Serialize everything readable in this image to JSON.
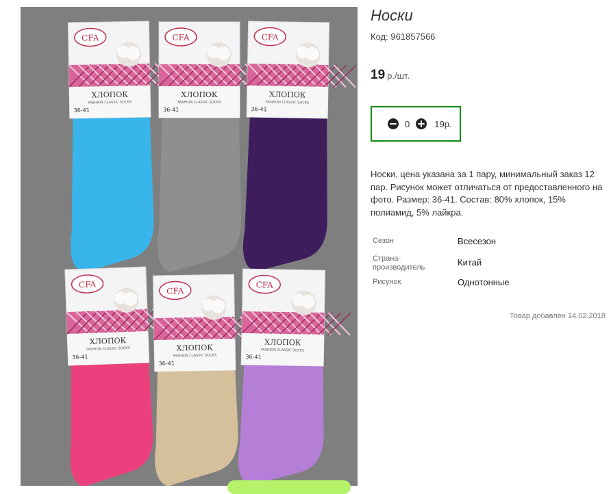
{
  "product": {
    "title": "Носки",
    "code_label": "Код:",
    "code_value": "961857566",
    "price_value": "19",
    "price_unit": "р./шт.",
    "quantity": "0",
    "total": "19р.",
    "description": "Носки, цена указана за 1 пару, минимальный заказ 12 пар. Рисунок может отличаться от предоставленного на фото. Размер: 36-41. Состав: 80% хлопок, 15% полиамид, 5% лайкра.",
    "added_text": "Товар добавлен 14.02.2018"
  },
  "properties": [
    {
      "label": "Сезон",
      "value": "Всесезон"
    },
    {
      "label": "Страна-производитель",
      "value": "Китай"
    },
    {
      "label": "Рисунок",
      "value": "Однотонные"
    }
  ],
  "photo": {
    "background": "#7f7f80",
    "pack_brand": "CFA",
    "pack_title": "ХЛОПОК",
    "pack_subtitle": "FASHION CLASSIC SOCKS",
    "pack_size": "36-41",
    "sock_colors": [
      "#38b6ec",
      "#8f8f91",
      "#3d1d5c",
      "#ec3f7d",
      "#d6c09c",
      "#b57fd8"
    ]
  },
  "colors": {
    "accent_border": "#118a11",
    "button_pill": "#b5f36a"
  }
}
